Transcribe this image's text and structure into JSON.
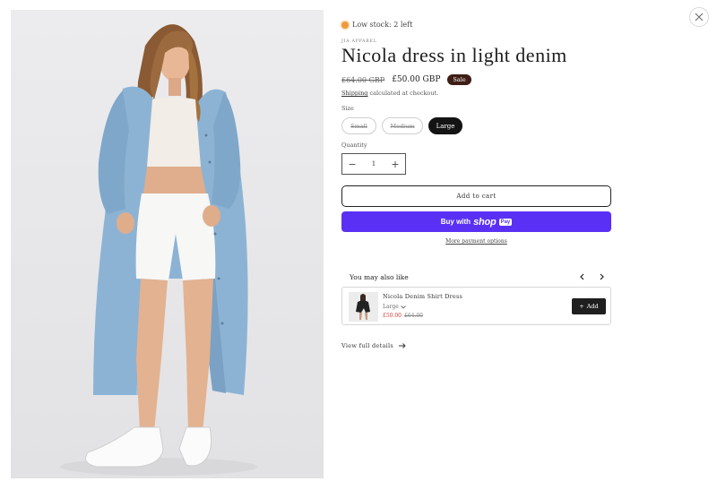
{
  "product": {
    "stock_status": "Low stock: 2 left",
    "vendor": "JIA APPAREL",
    "title": "Nicola dress in light denim",
    "price_original": "£64.00 GBP",
    "price_sale": "£50.00 GBP",
    "sale_badge": "Sale",
    "shipping_link": "Shipping",
    "shipping_text": " calculated at checkout.",
    "image_alt": "Model wearing light denim shirt dress with white top, white shorts and sneakers"
  },
  "size": {
    "label": "Size",
    "options": [
      {
        "label": "Small",
        "state": "unavailable"
      },
      {
        "label": "Medium",
        "state": "unavailable"
      },
      {
        "label": "Large",
        "state": "selected"
      }
    ]
  },
  "quantity": {
    "label": "Quantity",
    "value": "1",
    "minus": "−",
    "plus": "+"
  },
  "actions": {
    "add_to_cart": "Add to cart",
    "buy_with": "Buy with",
    "shop": "shop",
    "pay": "Pay",
    "more_payment": "More payment options"
  },
  "recommendations": {
    "title": "You may also like",
    "items": [
      {
        "name": "Nicola Denim Shirt Dress",
        "variant": "Large",
        "price_sale": "£50.00",
        "price_original": "£64.00",
        "add_label": "Add",
        "add_symbol": "+"
      }
    ]
  },
  "footer": {
    "view_full_details": "View full details"
  },
  "colors": {
    "sale_badge_bg": "#3e1e15",
    "shop_pay": "#5a31f4",
    "stock_dot": "#ee9a3a",
    "rec_sale_price": "#d23c3c"
  }
}
